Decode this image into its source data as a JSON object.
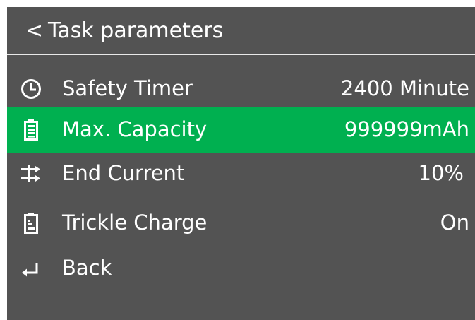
{
  "header": {
    "back_symbol": "<",
    "title": "Task parameters"
  },
  "items": [
    {
      "icon": "clock-icon",
      "label": "Safety Timer",
      "value": "2400 Minute",
      "selected": false
    },
    {
      "icon": "battery-full-icon",
      "label": "Max. Capacity",
      "value": "999999mAh",
      "selected": true
    },
    {
      "icon": "arrows-current-icon",
      "label": "End Current",
      "value": "10%",
      "selected": false
    },
    {
      "icon": "battery-trickle-icon",
      "label": "Trickle Charge",
      "value": "On",
      "selected": false
    },
    {
      "icon": "return-icon",
      "label": "Back",
      "value": "",
      "selected": false
    }
  ],
  "colors": {
    "background": "#535353",
    "selected": "#00b050",
    "text": "#ffffff"
  }
}
